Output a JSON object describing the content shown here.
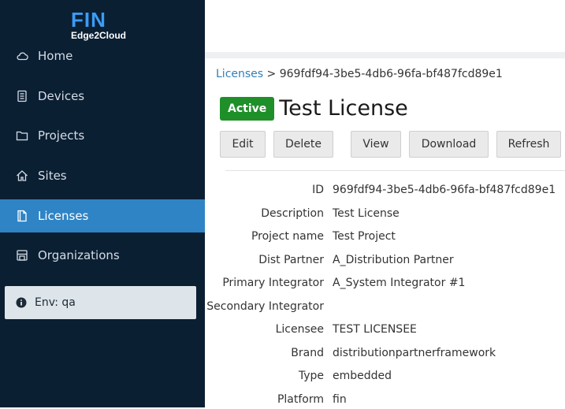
{
  "brand": {
    "name": "FIN",
    "subtitle": "Edge2Cloud"
  },
  "sidebar": {
    "items": [
      {
        "label": "Home",
        "icon": "cloud-icon"
      },
      {
        "label": "Devices",
        "icon": "device-icon"
      },
      {
        "label": "Projects",
        "icon": "folder-icon"
      },
      {
        "label": "Sites",
        "icon": "home-icon"
      },
      {
        "label": "Licenses",
        "icon": "license-icon",
        "active": true
      },
      {
        "label": "Organizations",
        "icon": "organization-icon"
      }
    ],
    "env": {
      "label": "Env: qa",
      "icon": "info-icon"
    }
  },
  "breadcrumb": {
    "root": "Licenses",
    "separator": ">",
    "current": "969fdf94-3be5-4db6-96fa-bf487fcd89e1"
  },
  "header": {
    "status": "Active",
    "title": "Test License"
  },
  "toolbar": {
    "edit": "Edit",
    "delete": "Delete",
    "view": "View",
    "download": "Download",
    "refresh": "Refresh"
  },
  "details": [
    {
      "label": "ID",
      "value": "969fdf94-3be5-4db6-96fa-bf487fcd89e1"
    },
    {
      "label": "Description",
      "value": "Test License"
    },
    {
      "label": "Project name",
      "value": "Test Project"
    },
    {
      "label": "Dist Partner",
      "value": "A_Distribution Partner"
    },
    {
      "label": "Primary Integrator",
      "value": "A_System Integrator #1"
    },
    {
      "label": "Secondary Integrator",
      "value": ""
    },
    {
      "label": "Licensee",
      "value": "TEST LICENSEE"
    },
    {
      "label": "Brand",
      "value": "distributionpartnerframework"
    },
    {
      "label": "Type",
      "value": "embedded"
    },
    {
      "label": "Platform",
      "value": "fin"
    }
  ],
  "colors": {
    "sidebar": "#0b1f33",
    "active": "#2f84c5",
    "badge": "#1f8f2a",
    "link": "#2f7fb8"
  }
}
